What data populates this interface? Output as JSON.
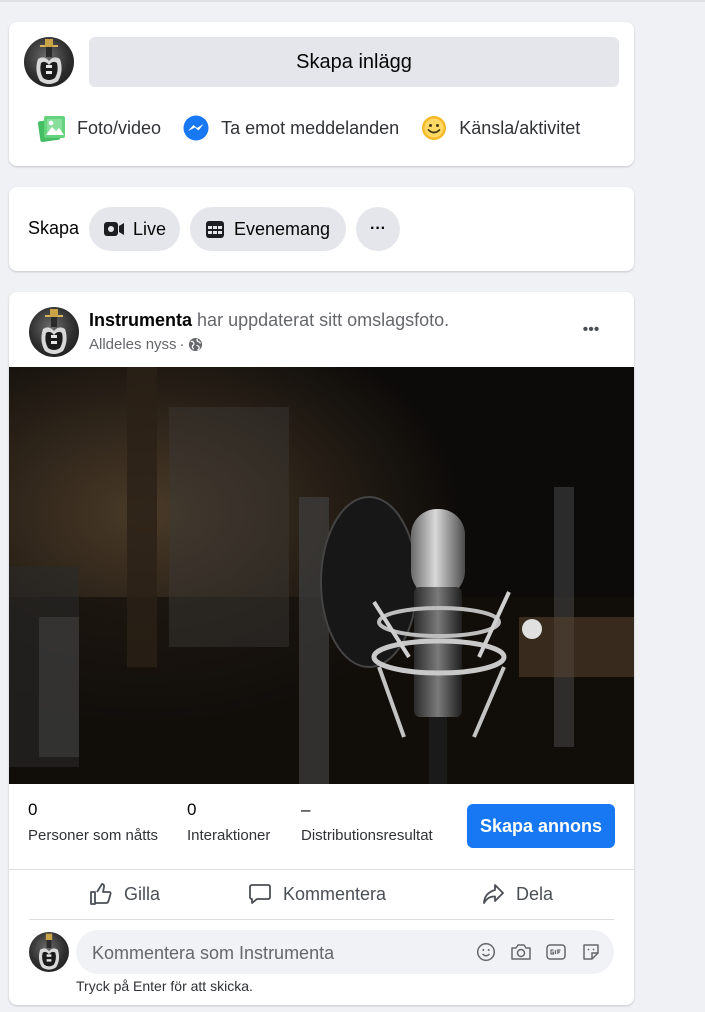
{
  "composer": {
    "prompt": "Skapa inlägg",
    "actions": [
      {
        "label": "Foto/video",
        "icon": "photo-video-icon",
        "color": "#45bd62"
      },
      {
        "label": "Ta emot meddelanden",
        "icon": "messenger-icon",
        "color": "#1877f2"
      },
      {
        "label": "Känsla/aktivitet",
        "icon": "smiley-icon",
        "color": "#f7b928"
      }
    ]
  },
  "create": {
    "label": "Skapa",
    "live": "Live",
    "event": "Evenemang",
    "more": "···"
  },
  "post": {
    "author": "Instrumenta",
    "action_text": "har uppdaterat sitt omslagsfoto.",
    "time": "Alldeles nyss",
    "separator": "·",
    "privacy_icon": "globe-icon",
    "more": "•••",
    "image": "microphone-studio-photo",
    "stats": [
      {
        "value": "0",
        "label": "Personer som nåtts"
      },
      {
        "value": "0",
        "label": "Interaktioner"
      },
      {
        "value": "–",
        "label": "Distributionsresultat"
      }
    ],
    "ad_button": "Skapa annons",
    "actions": {
      "like": "Gilla",
      "comment": "Kommentera",
      "share": "Dela"
    },
    "comment_placeholder": "Kommentera som Instrumenta",
    "comment_hint": "Tryck på Enter för att skicka."
  },
  "colors": {
    "accent": "#1877f2",
    "background": "#eff1f5",
    "card": "#ffffff"
  }
}
